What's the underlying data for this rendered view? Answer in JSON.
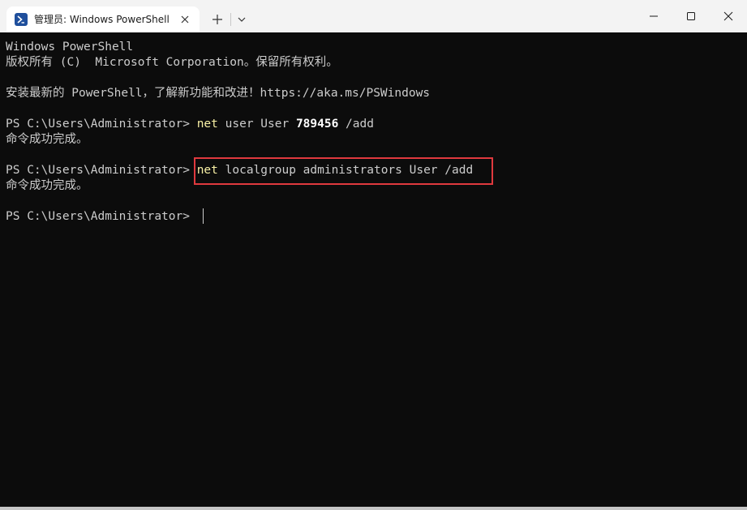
{
  "tab": {
    "title": "管理员: Windows PowerShell",
    "icon": "powershell-icon"
  },
  "window_controls": {
    "minimize": "minimize-icon",
    "maximize": "maximize-icon",
    "close": "close-icon"
  },
  "terminal": {
    "header_line1": "Windows PowerShell",
    "header_line2": "版权所有 (C)  Microsoft Corporation。保留所有权利。",
    "install_hint": "安装最新的 PowerShell，了解新功能和改进！https://aka.ms/PSWindows",
    "prompt": "PS C:\\Users\\Administrator> ",
    "cmd1": {
      "command": "net",
      "args_before": " user User ",
      "number": "789456",
      "args_after": " /add",
      "result": "命令成功完成。"
    },
    "cmd2": {
      "command": "net",
      "args": " localgroup administrators User /add",
      "result": "命令成功完成。"
    }
  },
  "colors": {
    "background": "#0c0c0c",
    "text": "#cccccc",
    "command": "#f9f1a5",
    "highlight_border": "#e0393e"
  }
}
